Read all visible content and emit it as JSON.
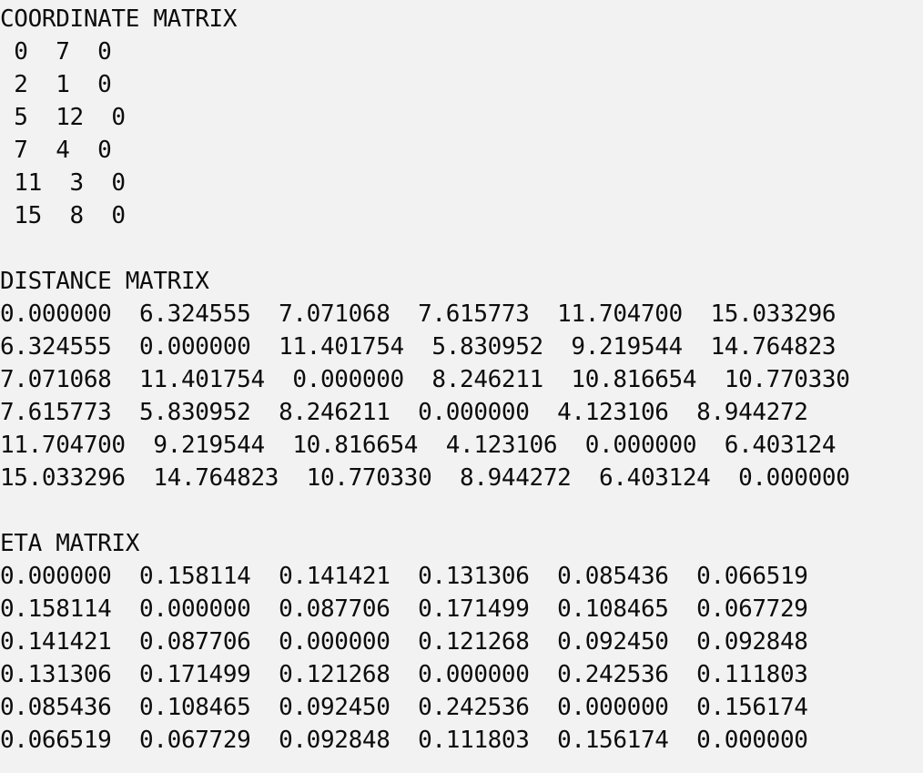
{
  "lines": [
    "COORDINATE MATRIX",
    " 0  7  0",
    " 2  1  0",
    " 5  12  0",
    " 7  4  0",
    " 11  3  0",
    " 15  8  0",
    "",
    "DISTANCE MATRIX",
    "0.000000  6.324555  7.071068  7.615773  11.704700  15.033296",
    "6.324555  0.000000  11.401754  5.830952  9.219544  14.764823",
    "7.071068  11.401754  0.000000  8.246211  10.816654  10.770330",
    "7.615773  5.830952  8.246211  0.000000  4.123106  8.944272",
    "11.704700  9.219544  10.816654  4.123106  0.000000  6.403124",
    "15.033296  14.764823  10.770330  8.944272  6.403124  0.000000",
    "",
    "ETA MATRIX",
    "0.000000  0.158114  0.141421  0.131306  0.085436  0.066519",
    "0.158114  0.000000  0.087706  0.171499  0.108465  0.067729",
    "0.141421  0.087706  0.000000  0.121268  0.092450  0.092848",
    "0.131306  0.171499  0.121268  0.000000  0.242536  0.111803",
    "0.085436  0.108465  0.092450  0.242536  0.000000  0.156174",
    "0.066519  0.067729  0.092848  0.111803  0.156174  0.000000"
  ]
}
